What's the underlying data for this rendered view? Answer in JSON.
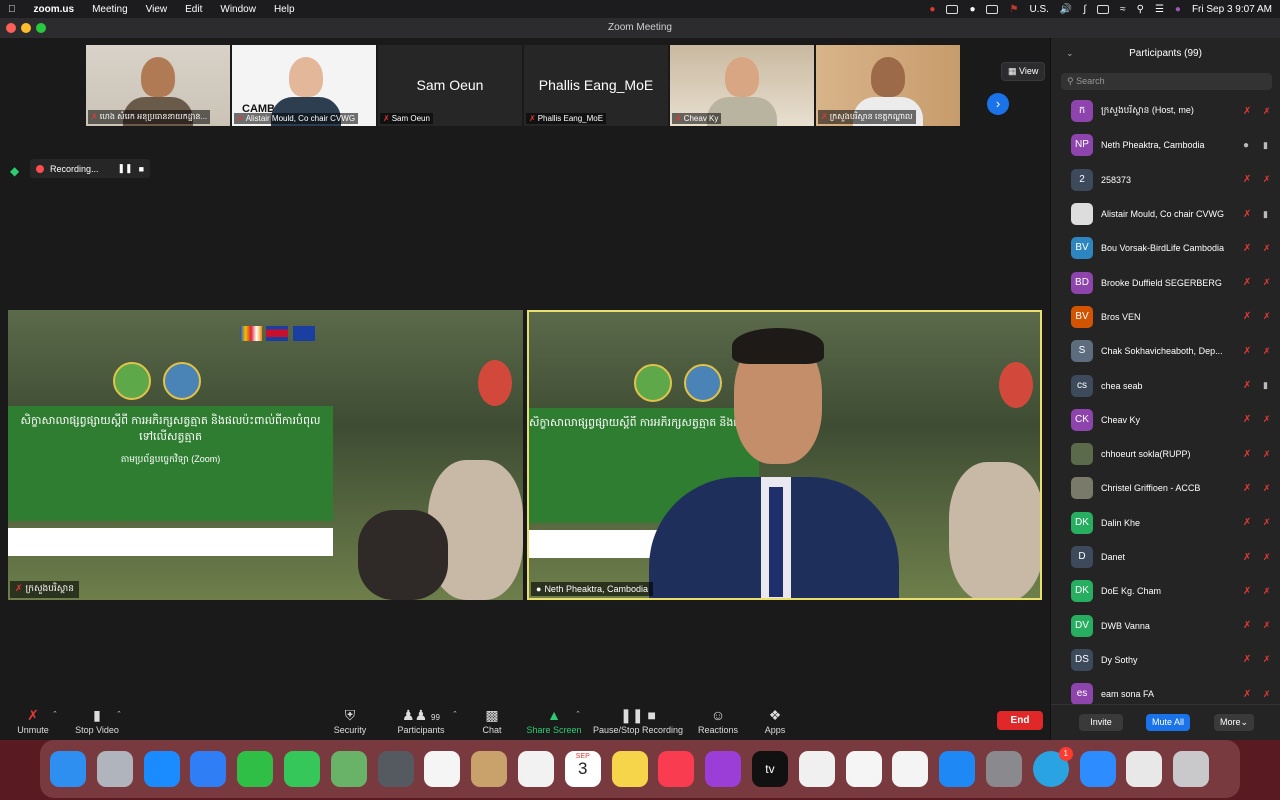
{
  "menubar": {
    "app_name": "zoom.us",
    "items": [
      "Meeting",
      "View",
      "Edit",
      "Window",
      "Help"
    ],
    "locale": "U.S.",
    "datetime": "Fri Sep 3  9:07 AM"
  },
  "window": {
    "title": "Zoom Meeting"
  },
  "view_button": {
    "label": "View"
  },
  "thumbnails": [
    {
      "name": "ហេង សំរេក អនុប្រធាននាយកដ្ឋាន..."
    },
    {
      "name": "Alistair Mould, Co chair CVWG",
      "banner_text": "CAMBODIA"
    },
    {
      "name": "Sam Oeun",
      "center": "Sam Oeun"
    },
    {
      "name": "Phallis Eang_MoE",
      "center": "Phallis Eang_MoE"
    },
    {
      "name": "Cheav Ky"
    },
    {
      "name": "ក្រសួងបរិស្ថាន ខេត្តកណ្តាល"
    }
  ],
  "recording": {
    "label": "Recording..."
  },
  "main": {
    "tile1_name": "ក្រសួងបរិស្ថាន",
    "tile2_name": "Neth Pheaktra, Cambodia",
    "slide_text": "សិក្ខាសាលាផ្សព្វផ្សាយស្តីពី ការអភិរក្សសត្វត្មាត និងផលប៉ះពាល់ពីការបំពុលទៅលើសត្វត្មាត",
    "slide_sub": "តាមប្រព័ន្ធបច្ចេកវិទ្យា (Zoom)"
  },
  "toolbar": {
    "unmute": "Unmute",
    "stop_video": "Stop Video",
    "security": "Security",
    "participants": "Participants",
    "participants_count": "99",
    "chat": "Chat",
    "share": "Share Screen",
    "record": "Pause/Stop Recording",
    "reactions": "Reactions",
    "apps": "Apps",
    "end": "End"
  },
  "panel": {
    "title": "Participants (99)",
    "search_placeholder": "Search",
    "participants": [
      {
        "initials": "ក",
        "name": "ក្រសួងបរិស្ថាន (Host, me)",
        "color": "#8e44ad",
        "mic": "off",
        "cam": "off"
      },
      {
        "initials": "NP",
        "name": "Neth Pheaktra, Cambodia",
        "color": "#8e44ad",
        "mic": "on",
        "cam": "on"
      },
      {
        "initials": "2",
        "name": "258373",
        "color": "#3d4a5c",
        "mic": "off",
        "cam": "off"
      },
      {
        "initials": "",
        "name": "Alistair Mould, Co chair CVWG",
        "color": "#dddddd",
        "mic": "off",
        "cam": "on"
      },
      {
        "initials": "BV",
        "name": "Bou Vorsak-BirdLife Cambodia",
        "color": "#2e86c1",
        "mic": "off",
        "cam": "off"
      },
      {
        "initials": "BD",
        "name": "Brooke Duffield SEGERBERG",
        "color": "#8e44ad",
        "mic": "off",
        "cam": "off"
      },
      {
        "initials": "BV",
        "name": "Bros VEN",
        "color": "#d35400",
        "mic": "off",
        "cam": "off"
      },
      {
        "initials": "S",
        "name": "Chak Sokhavicheaboth, Dep...",
        "color": "#5d6d7e",
        "mic": "off",
        "cam": "off"
      },
      {
        "initials": "cs",
        "name": "chea seab",
        "color": "#3d4a5c",
        "mic": "off",
        "cam": "on"
      },
      {
        "initials": "CK",
        "name": "Cheav Ky",
        "color": "#8e44ad",
        "mic": "off",
        "cam": "off"
      },
      {
        "initials": "",
        "name": "chhoeurt sokla(RUPP)",
        "color": "#5a6a4a",
        "mic": "off",
        "cam": "off"
      },
      {
        "initials": "",
        "name": "Christel Griffioen - ACCB",
        "color": "#7a7a6a",
        "mic": "off",
        "cam": "off"
      },
      {
        "initials": "DK",
        "name": "Dalin Khe",
        "color": "#27ae60",
        "mic": "off",
        "cam": "off"
      },
      {
        "initials": "D",
        "name": "Danet",
        "color": "#3d4a5c",
        "mic": "off",
        "cam": "off"
      },
      {
        "initials": "DK",
        "name": "DoE Kg. Cham",
        "color": "#27ae60",
        "mic": "off",
        "cam": "off"
      },
      {
        "initials": "DV",
        "name": "DWB  Vanna",
        "color": "#27ae60",
        "mic": "off",
        "cam": "off"
      },
      {
        "initials": "DS",
        "name": "Dy Sothy",
        "color": "#3d4a5c",
        "mic": "off",
        "cam": "off"
      },
      {
        "initials": "es",
        "name": "eam sona FA",
        "color": "#8e44ad",
        "mic": "off",
        "cam": "off"
      }
    ],
    "invite": "Invite",
    "mute_all": "Mute All",
    "more": "More"
  },
  "dock": {
    "calendar_month": "SEP",
    "calendar_day": "3",
    "telegram_badge": "1",
    "tv_label": "tv",
    "icons": [
      "finder-icon",
      "launchpad-icon",
      "safari-icon",
      "mail-icon",
      "facetime-icon",
      "messages-icon",
      "maps-icon",
      "screenshot-icon",
      "photos-icon",
      "contacts-icon",
      "reminders-icon",
      "calendar-icon",
      "notes-icon",
      "music-icon",
      "podcasts-icon",
      "tv-icon",
      "news-icon",
      "numbers-icon",
      "pages-icon",
      "app-store-icon",
      "system-preferences-icon",
      "telegram-icon",
      "zoom-icon",
      "document-icon",
      "trash-icon"
    ]
  }
}
